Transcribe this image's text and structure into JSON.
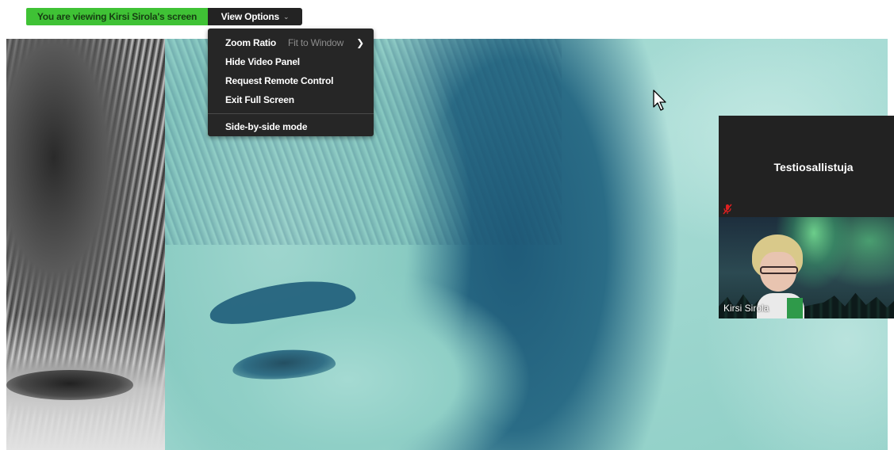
{
  "top_bar": {
    "viewing_text": "You are viewing Kirsi Sirola's screen",
    "view_options_label": "View Options",
    "banner_color": "#3fc235"
  },
  "dropdown": {
    "items": [
      {
        "label": "Zoom Ratio",
        "value": "Fit to Window",
        "has_submenu": true
      },
      {
        "label": "Hide Video Panel"
      },
      {
        "label": "Request Remote Control"
      },
      {
        "label": "Exit Full Screen"
      },
      {
        "label": "Side-by-side mode"
      }
    ]
  },
  "video_panel": {
    "participant_name": "Testiosallistuja",
    "participant_muted_icon": "mic-muted-icon",
    "self_name": "Kirsi Sirola"
  },
  "icons": {
    "dropdown_chevron": "chevron-down-icon",
    "submenu_chevron": "chevron-right-icon",
    "cursor": "mouse-pointer-icon"
  }
}
